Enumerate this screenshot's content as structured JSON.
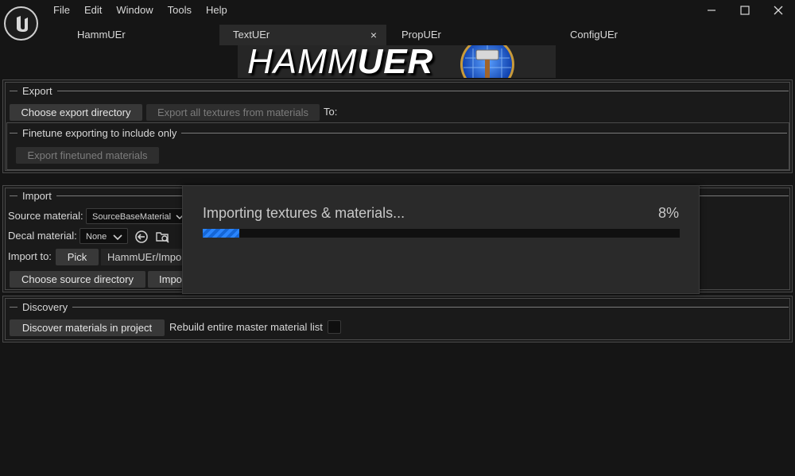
{
  "menu": [
    "File",
    "Edit",
    "Window",
    "Tools",
    "Help"
  ],
  "tabs": [
    {
      "label": "HammUEr"
    },
    {
      "label": "TextUEr",
      "close": "×"
    },
    {
      "label": "PropUEr"
    },
    {
      "label": "ConfigUEr"
    }
  ],
  "banner": {
    "text_a": "HAMM",
    "text_b": "UER"
  },
  "export": {
    "legend": "Export",
    "choose_dir": "Choose export directory",
    "export_all": "Export all textures from materials",
    "to_label": "To:",
    "finetune": {
      "legend": "Finetune exporting to include only",
      "button": "Export finetuned materials"
    }
  },
  "import": {
    "legend": "Import",
    "source_label": "Source material:",
    "source_value": "SourceBaseMaterial",
    "decal_label": "Decal material:",
    "decal_value": "None",
    "import_to_label": "Import to:",
    "pick": "Pick",
    "path_value": "HammUEr/Impo",
    "choose_source": "Choose source directory",
    "import_partial": "Impo"
  },
  "discovery": {
    "legend": "Discovery",
    "discover_button": "Discover materials in project",
    "rebuild_label": "Rebuild entire master material list",
    "rebuild_checked": false
  },
  "progress": {
    "title": "Importing textures & materials...",
    "percent_text": "8%",
    "fraction": 0.08,
    "accent": "#1a73e8"
  },
  "icons": [
    "unreal-logo-icon",
    "minimize-icon",
    "maximize-icon",
    "close-icon",
    "chevron-down-icon",
    "back-arrow-icon",
    "browse-folder-icon"
  ]
}
